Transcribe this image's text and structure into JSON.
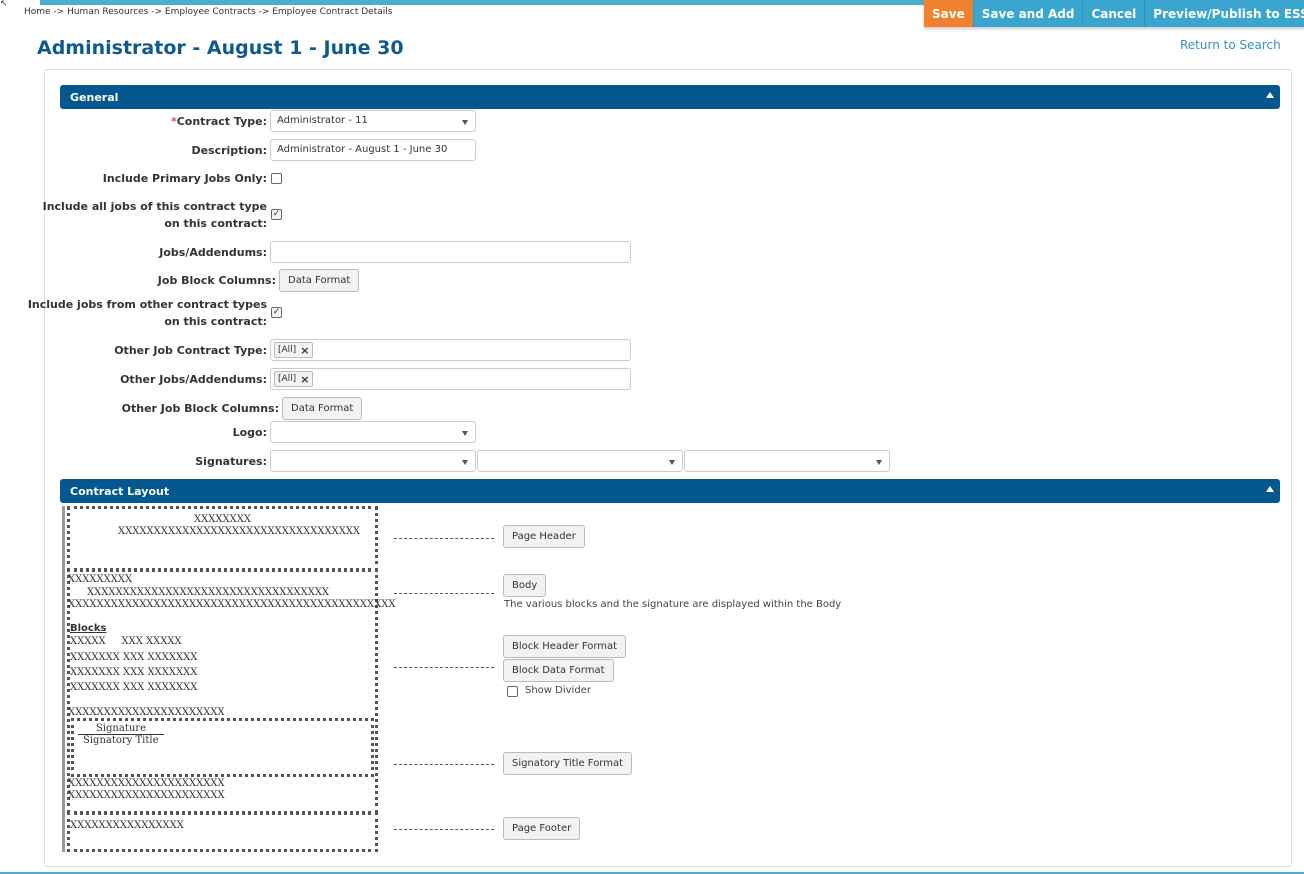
{
  "app": {
    "breadcrumb": "Home -> Human Resources -> Employee Contracts -> Employee Contract Details",
    "cursor_glyph": "↖"
  },
  "toolbar": {
    "save": "Save",
    "save_and_add": "Save and Add",
    "cancel": "Cancel",
    "preview_publish": "Preview/Publish to ESS"
  },
  "page": {
    "title": "Administrator - August 1 - June 30",
    "return_link": "Return to Search"
  },
  "general": {
    "header": "General",
    "contract_type": {
      "required_mark": "*",
      "label": "Contract Type:",
      "value": "Administrator - 11"
    },
    "description": {
      "label": "Description:",
      "value": "Administrator - August 1 - June 30"
    },
    "include_primary_jobs_only": {
      "label": "Include Primary Jobs Only:",
      "checked": false
    },
    "include_all_jobs": {
      "label_line1": "Include all jobs of this contract type",
      "label_line2": "on this contract:",
      "checked": true
    },
    "jobs_addendums": {
      "label": "Jobs/Addendums:",
      "value": ""
    },
    "job_block_columns": {
      "label": "Job Block Columns:",
      "button": "Data Format"
    },
    "include_other_types": {
      "label_line1": "Include jobs from other contract types",
      "label_line2": "on this contract:",
      "checked": true
    },
    "other_job_contract_type": {
      "label": "Other Job Contract Type:",
      "tag": "[All]"
    },
    "other_jobs_addendums": {
      "label": "Other Jobs/Addendums:",
      "tag": "[All]"
    },
    "other_job_block_columns": {
      "label": "Other Job Block Columns:",
      "button": "Data Format"
    },
    "logo": {
      "label": "Logo:",
      "value": ""
    },
    "signatures": {
      "label": "Signatures:",
      "values": [
        "",
        "",
        ""
      ]
    }
  },
  "contract_layout": {
    "header": "Contract Layout",
    "preview": {
      "header_line1": "XXXXXXXX",
      "header_line2": "XXXXXXXXXXXXXXXXXXXXXXXXXXXXXXXXXX",
      "body_line1": "XXXXXXXXX",
      "body_line2": "XXXXXXXXXXXXXXXXXXXXXXXXXXXXXXXXXX",
      "body_line3": "XXXXXXXXXXXXXXXXXXXXXXXXXXXXXXXXXXXXXXXXXXXXXX",
      "blocks_label": "Blocks",
      "blocks_header": "XXXXX     XXX XXXXX",
      "block_rows": [
        "XXXXXXX XXX XXXXXXX",
        "XXXXXXX XXX XXXXXXX",
        "XXXXXXX XXX XXXXXXX"
      ],
      "body_line4": "XXXXXXXXXXXXXXXXXXXXXX",
      "signature": "Signature",
      "signatory_title": "Signatory Title",
      "after_sig_1": "XXXXXXXXXXXXXXXXXXXXXX",
      "after_sig_2": "XXXXXXXXXXXXXXXXXXXXXX",
      "footer": "XXXXXXXXXXXXXXXX"
    },
    "buttons": {
      "page_header": "Page Header",
      "body": "Body",
      "body_note": "The various blocks and the signature are displayed within the Body",
      "block_header_format": "Block Header Format",
      "block_data_format": "Block Data Format",
      "show_divider": "Show Divider",
      "signatory_title_format": "Signatory Title Format",
      "page_footer": "Page Footer"
    }
  }
}
